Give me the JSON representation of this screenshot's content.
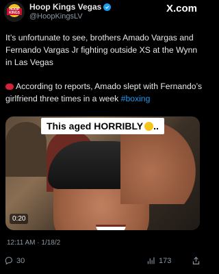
{
  "header": {
    "display_name": "Hoop Kings Vegas",
    "handle": "@HoopKingsLV",
    "brand": "X.com",
    "avatar_text": "HOOP KINGS"
  },
  "tweet": {
    "paragraph1": "It’s unfortunate to see, brothers Amado Vargas and Fernando Vargas Jr fighting outside XS at the Wynn in Las Vegas",
    "paragraph2_text": "According to reports, Amado slept with Fernando’s girlfriend three times in a week ",
    "hashtag": "#boxing"
  },
  "media": {
    "caption": "This aged HORRIBLY",
    "caption_suffix": "..",
    "duration": "0:20"
  },
  "meta": {
    "timestamp": "12:11 AM · 1/18/2"
  },
  "actions": {
    "replies": "30",
    "views": "173"
  },
  "icons": {
    "verified": "verified-badge-icon",
    "reply": "reply-icon",
    "views": "views-icon",
    "share": "share-icon",
    "gloves": "boxing-glove-emoji",
    "grimace": "grimacing-face-emoji"
  },
  "colors": {
    "accent": "#1d9bf0",
    "background": "#000000",
    "muted": "#8b98a5"
  }
}
